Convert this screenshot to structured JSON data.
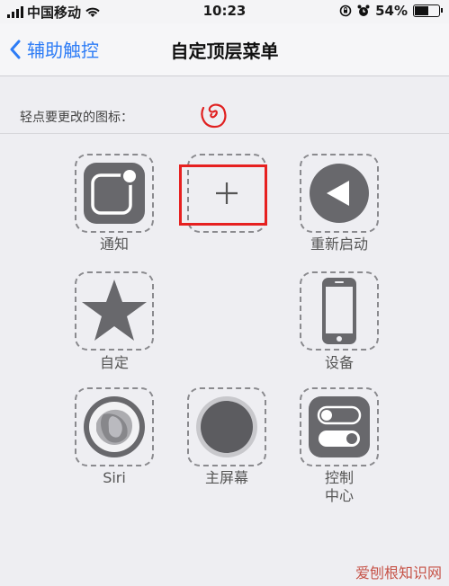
{
  "status_bar": {
    "carrier": "中国移动",
    "time": "10:23",
    "battery": "54%",
    "battery_level": 0.54,
    "icons": [
      "signal-icon",
      "wifi-icon",
      "rotation-lock-icon",
      "alarm-icon",
      "battery-icon"
    ]
  },
  "nav": {
    "back_label": "辅助触控",
    "title": "自定顶层菜单"
  },
  "hint": "轻点要更改的图标：",
  "slots": [
    {
      "id": "notification",
      "label": "通知",
      "icon": "notification-icon"
    },
    {
      "id": "add",
      "label": "",
      "icon": "plus-icon"
    },
    {
      "id": "restart",
      "label": "重新启动",
      "icon": "restart-icon"
    },
    {
      "id": "custom",
      "label": "自定",
      "icon": "star-icon"
    },
    {
      "id": "device",
      "label": "设备",
      "icon": "device-icon"
    },
    {
      "id": "siri",
      "label": "Siri",
      "icon": "siri-icon"
    },
    {
      "id": "home",
      "label": "主屏幕",
      "icon": "home-button-icon"
    },
    {
      "id": "control_center",
      "label": "控制\n中心",
      "icon": "control-center-icon"
    }
  ],
  "watermark": "爱刨根知识网",
  "colors": {
    "accent": "#2d7cf6",
    "highlight": "#e62020",
    "icon_fill": "#68686c"
  }
}
